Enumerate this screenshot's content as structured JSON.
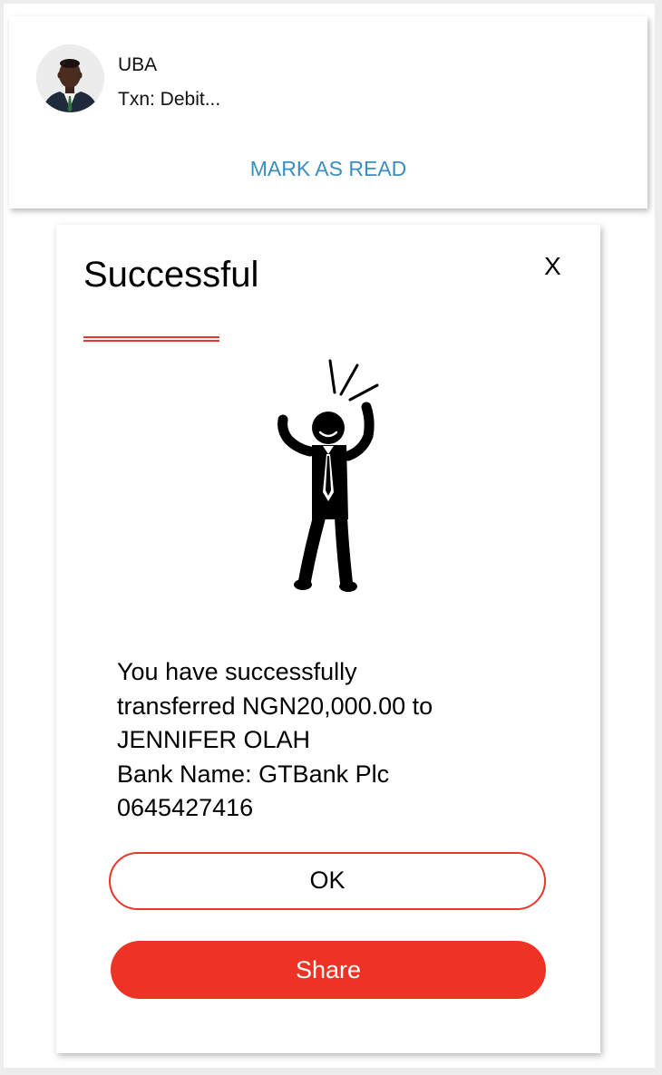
{
  "notification": {
    "sender": "UBA",
    "preview": "Txn: Debit...",
    "mark_read_label": "MARK AS READ",
    "avatar_icon": "user-avatar-photo"
  },
  "modal": {
    "title": "Successful",
    "close_label": "X",
    "illustration_icon": "celebrating-person-icon",
    "message_lines": [
      "You have successfully",
      "transferred NGN20,000.00 to",
      "JENNIFER OLAH",
      "Bank Name: GTBank Plc",
      "0645427416"
    ],
    "ok_label": "OK",
    "share_label": "Share"
  },
  "colors": {
    "accent_red": "#ee3224",
    "link_blue": "#3a8fc0"
  }
}
